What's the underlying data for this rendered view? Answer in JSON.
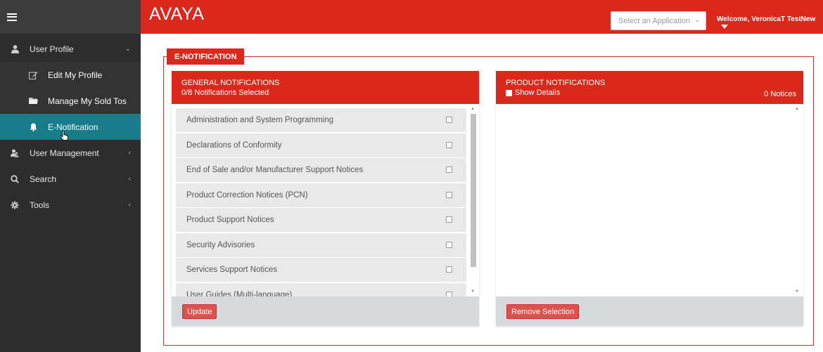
{
  "header": {
    "logo_text": "AVAYA",
    "select_application_placeholder": "Select an Application",
    "welcome_text": "Welcome, VeronicaT TestNew"
  },
  "sidebar": {
    "items": [
      {
        "label": "User Profile",
        "icon": "user-icon"
      },
      {
        "label": "Edit My Profile",
        "icon": "edit-icon"
      },
      {
        "label": "Manage My Sold Tos",
        "icon": "folder-icon"
      },
      {
        "label": "E-Notification",
        "icon": "bell-icon"
      },
      {
        "label": "User Management",
        "icon": "users-icon"
      },
      {
        "label": "Search",
        "icon": "search-icon"
      },
      {
        "label": "Tools",
        "icon": "gear-icon"
      }
    ]
  },
  "main": {
    "section_title": "E-NOTIFICATION",
    "general": {
      "title": "GENERAL NOTIFICATIONS",
      "subtitle": "0/8 Notifications Selected",
      "items": [
        "Administration and System Programming",
        "Declarations of Conformity",
        "End of Sale and/or Manufacturer Support Notices",
        "Product Correction Notices (PCN)",
        "Product Support Notices",
        "Security Advisories",
        "Services Support Notices",
        "User Guides (Multi-language)"
      ],
      "update_label": "Update"
    },
    "product": {
      "title": "PRODUCT NOTIFICATIONS",
      "show_details_label": "Show Details",
      "notices_count": "0 Notices",
      "remove_label": "Remove Selection"
    }
  },
  "colors": {
    "brand_red": "#da291c",
    "sidebar_bg": "#2d2d2d",
    "active_teal": "#187c8a",
    "button_red": "#d9534f"
  }
}
